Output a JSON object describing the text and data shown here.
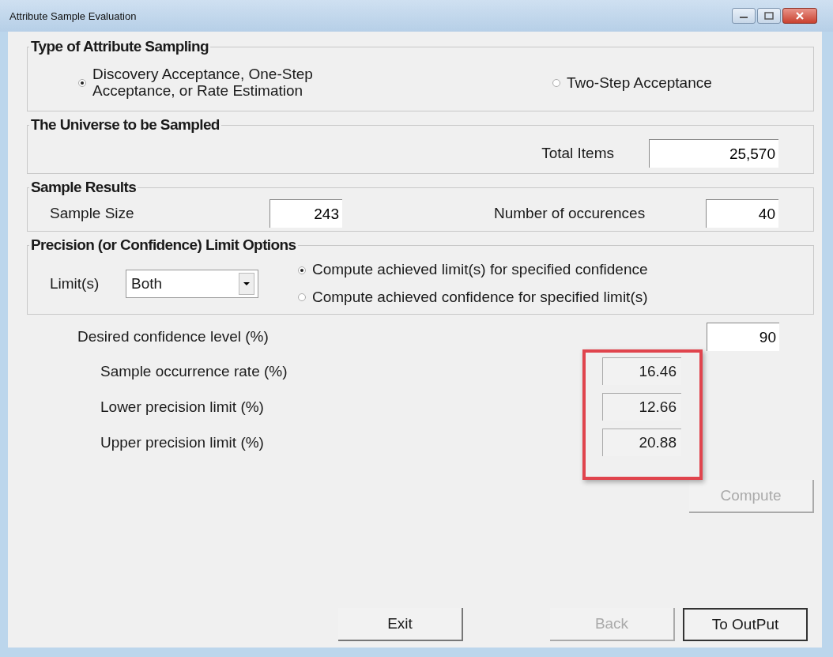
{
  "window": {
    "title": "Attribute Sample Evaluation"
  },
  "sampling_type": {
    "title": "Type of Attribute Sampling",
    "options": [
      {
        "label": "Discovery Acceptance, One-Step\nAcceptance, or Rate Estimation",
        "selected": true
      },
      {
        "label": "Two-Step Acceptance",
        "selected": false
      }
    ]
  },
  "universe": {
    "title": "The Universe to be Sampled",
    "total_items": {
      "label": "Total Items",
      "value": "25,570"
    }
  },
  "sample_results": {
    "title": "Sample Results",
    "fields": [
      {
        "label": "Sample Size",
        "value": "243"
      },
      {
        "label": "Number of occurences",
        "value": "40"
      }
    ]
  },
  "precision": {
    "title": "Precision (or Confidence) Limit Options",
    "limits": {
      "label": "Limit(s)",
      "value": "Both"
    },
    "options": [
      {
        "label": "Compute achieved limit(s) for specified confidence",
        "selected": true
      },
      {
        "label": "Compute achieved confidence for specified limit(s)",
        "selected": false
      }
    ]
  },
  "confidence": {
    "label": "Desired confidence level (%)",
    "value": "90"
  },
  "results": [
    {
      "label": "Sample occurrence rate (%)",
      "value": "16.46"
    },
    {
      "label": "Lower precision limit (%)",
      "value": "12.66"
    },
    {
      "label": "Upper precision limit (%)",
      "value": "20.88"
    }
  ],
  "compute_button": {
    "label": "Compute",
    "disabled": true
  },
  "buttons": [
    {
      "label": "Exit",
      "disabled": false,
      "default": false
    },
    {
      "label": "Back",
      "disabled": true,
      "default": false
    },
    {
      "label": "To OutPut",
      "disabled": false,
      "default": true
    }
  ]
}
